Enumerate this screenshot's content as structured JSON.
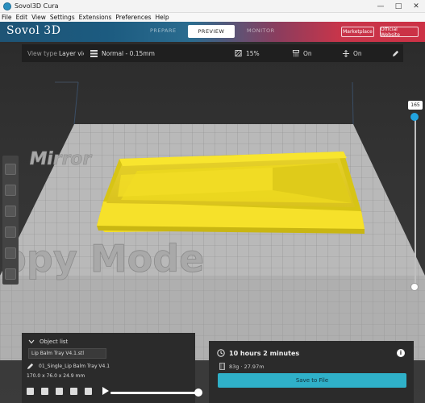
{
  "window": {
    "title": "Sovol3D Cura"
  },
  "menu": [
    "File",
    "Edit",
    "View",
    "Settings",
    "Extensions",
    "Preferences",
    "Help"
  ],
  "header": {
    "brand": "Sovol 3D",
    "stages": {
      "prepare": "PREPARE",
      "preview": "PREVIEW",
      "monitor": "MONITOR"
    },
    "marketplace": "Marketplace",
    "official_website": "Official Website"
  },
  "toolbar": {
    "view_type_label": "View type",
    "view_type_value": "Layer view",
    "profile": "Normal - 0.15mm",
    "infill": "15%",
    "support": "On",
    "adhesion": "On"
  },
  "scene": {
    "bed_text_1": "Mirror",
    "bed_text_2": "ppy Mode"
  },
  "layer_slider": {
    "value": "165"
  },
  "object_list": {
    "label": "Object list",
    "file": "Lip Balm Tray V4.1.stl",
    "object_name": "01_Single_Lip Balm Tray V4.1",
    "dimensions": "170.0 x 76.0 x 24.9 mm"
  },
  "print": {
    "time": "10 hours 2 minutes",
    "material": "83g · 27.97m",
    "save_label": "Save to File"
  },
  "colors": {
    "accent": "#22a4e0",
    "model": "#f6e12a",
    "save_button": "#2fb0c8"
  },
  "icons": [
    "gear-icon",
    "minimize-icon",
    "maximize-icon",
    "close-icon",
    "layers-icon",
    "infill-icon",
    "support-icon",
    "adhesion-icon",
    "edit-icon",
    "clock-icon",
    "info-icon",
    "chevron-down-icon",
    "pencil-icon",
    "play-icon"
  ]
}
